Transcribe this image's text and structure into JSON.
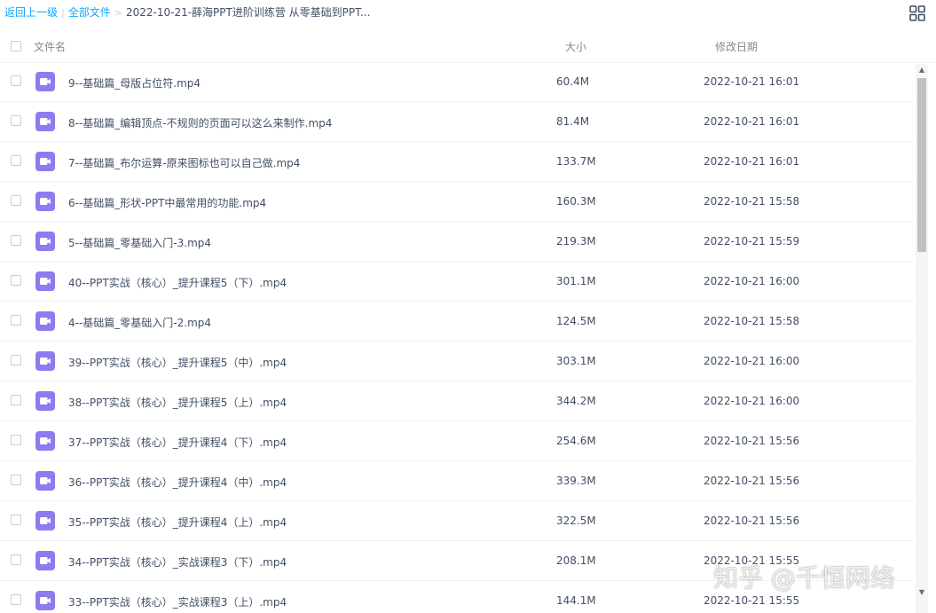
{
  "breadcrumb": {
    "back_label": "返回上一级",
    "separator_1": "|",
    "all_files_label": "全部文件",
    "separator_2": ">",
    "current_folder": "2022-10-21-薛海PPT进阶训练营 从零基础到PPT..."
  },
  "table": {
    "columns": {
      "name": "文件名",
      "size": "大小",
      "modified": "修改日期"
    },
    "rows": [
      {
        "name": "9--基础篇_母版占位符.mp4",
        "size": "60.4M",
        "modified": "2022-10-21 16:01"
      },
      {
        "name": "8--基础篇_编辑顶点-不规则的页面可以这么来制作.mp4",
        "size": "81.4M",
        "modified": "2022-10-21 16:01"
      },
      {
        "name": "7--基础篇_布尔运算-原来图标也可以自己做.mp4",
        "size": "133.7M",
        "modified": "2022-10-21 16:01"
      },
      {
        "name": "6--基础篇_形状-PPT中最常用的功能.mp4",
        "size": "160.3M",
        "modified": "2022-10-21 15:58"
      },
      {
        "name": "5--基础篇_零基础入门-3.mp4",
        "size": "219.3M",
        "modified": "2022-10-21 15:59"
      },
      {
        "name": "40--PPT实战（核心）_提升课程5（下）.mp4",
        "size": "301.1M",
        "modified": "2022-10-21 16:00"
      },
      {
        "name": "4--基础篇_零基础入门-2.mp4",
        "size": "124.5M",
        "modified": "2022-10-21 15:58"
      },
      {
        "name": "39--PPT实战（核心）_提升课程5（中）.mp4",
        "size": "303.1M",
        "modified": "2022-10-21 16:00"
      },
      {
        "name": "38--PPT实战（核心）_提升课程5（上）.mp4",
        "size": "344.2M",
        "modified": "2022-10-21 16:00"
      },
      {
        "name": "37--PPT实战（核心）_提升课程4（下）.mp4",
        "size": "254.6M",
        "modified": "2022-10-21 15:56"
      },
      {
        "name": "36--PPT实战（核心）_提升课程4（中）.mp4",
        "size": "339.3M",
        "modified": "2022-10-21 15:56"
      },
      {
        "name": "35--PPT实战（核心）_提升课程4（上）.mp4",
        "size": "322.5M",
        "modified": "2022-10-21 15:56"
      },
      {
        "name": "34--PPT实战（核心）_实战课程3（下）.mp4",
        "size": "208.1M",
        "modified": "2022-10-21 15:55"
      },
      {
        "name": "33--PPT实战（核心）_实战课程3（上）.mp4",
        "size": "144.1M",
        "modified": "2022-10-21 15:55"
      }
    ]
  },
  "icons": {
    "file_icon": "video-file-icon",
    "view_toggle": "grid-view-icon"
  },
  "colors": {
    "link": "#09aaff",
    "video_icon": "#8c7cf0",
    "text": "#424e67",
    "header_text": "#888888"
  },
  "watermark": "知乎 @千恒网络"
}
